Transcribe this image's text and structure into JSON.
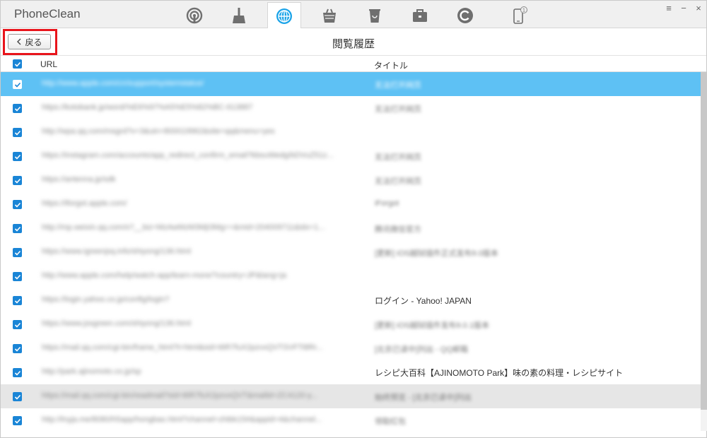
{
  "app": {
    "title": "PhoneClean"
  },
  "toolbar": {
    "tabs": [
      {
        "icon": "podcast-icon",
        "active": false
      },
      {
        "icon": "broom-icon",
        "active": false
      },
      {
        "icon": "globe-icon",
        "active": true
      },
      {
        "icon": "basket-icon",
        "active": false
      },
      {
        "icon": "trash-icon",
        "active": false
      },
      {
        "icon": "toolbox-icon",
        "active": false
      },
      {
        "icon": "refresh-c-icon",
        "active": false
      },
      {
        "icon": "phone-icon",
        "active": false,
        "badge": "1"
      }
    ],
    "window_controls": {
      "menu": "≡",
      "minimize": "−",
      "close": "×"
    }
  },
  "subheader": {
    "back_label": "戻る",
    "page_title": "閲覧履歴"
  },
  "table": {
    "columns": {
      "url": "URL",
      "title": "タイトル"
    },
    "rows": [
      {
        "url": "http://www.apple.com/cn/support/systemstatus/",
        "title": "无法打开网页",
        "selected": true
      },
      {
        "url": "https://kotobank.jp/word/%E6%97%A5%E5%82%BC-613887",
        "title": "无法打开网页"
      },
      {
        "url": "http://wpa.qq.com/msgrd?v=3&uin=800019962&site=qq&menu=yes",
        "title": ""
      },
      {
        "url": "https://instagram.com/accounts/app_redirect_confirm_email?kbsuWedg/bDVuZ51z...",
        "title": "无法打开网页"
      },
      {
        "url": "https://antenna.jp/sdk",
        "title": "无法打开网页"
      },
      {
        "url": "https://iforgot.apple.com/",
        "title": "iForgot"
      },
      {
        "url": "http://mp.weixin.qq.com/s?__biz=MzAwMzM3MjI3Mg==&mid=204009711&idx=1...",
        "title": "腾讯微信官方"
      },
      {
        "url": "https://www.igreenjsq.info/shiyong/136.html",
        "title": "[更新] iOS越狱插件正式发布9.0版本"
      },
      {
        "url": "http://www.apple.com/help/watch-app/learn-more/?country=JP&lang=ja",
        "title": ""
      },
      {
        "url": "https://login.yahoo.co.jp/config/login?",
        "title": "ログイン - Yahoo! JAPAN",
        "clear": true
      },
      {
        "url": "https://www.jssgreen.com/shiyong/136.html",
        "title": "[更新] iOS越狱插件发布9.0.1版本"
      },
      {
        "url": "https://mail.qq.com/cgi-bin/frame_html?t=html&sid=t6R7fuX2pzvxQVTSVFTi8Rr...",
        "title": "[北京已读中]列出 - QQ邮箱"
      },
      {
        "url": "http://park.ajinomoto.co.jp/sp",
        "title": "レシピ大百科【AJINOMOTO Park】味の素の料理・レシピサイト",
        "clear": true
      },
      {
        "url": "https://mail.qq.com/cgi-bin/readmail?sid=t6R7fuX2pzvxQVT&mailid=ZC4120-y...",
        "title": "始终预览 - [北京已读中]列出",
        "hover": true
      },
      {
        "url": "http://lnyja.me/8080/h5app/hongbao.html?channel=zhibk15#&appid=4&channel...",
        "title": "领取红包"
      }
    ]
  },
  "colors": {
    "selected_row": "#5ec1f4",
    "hover_row": "#e6e6e6",
    "checkbox": "#1a85d6",
    "active_icon": "#1aa3e8",
    "inactive_icon": "#6f6f6f",
    "highlight_box": "#e8141b"
  }
}
